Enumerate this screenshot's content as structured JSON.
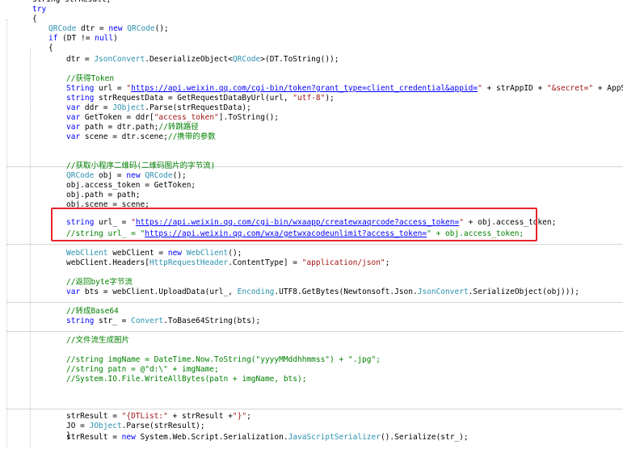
{
  "editor": {
    "lines": [
      [
        [
          "g",
          "string strResult;"
        ]
      ],
      [
        [
          "k",
          "try"
        ]
      ],
      [
        [
          "p",
          "{"
        ]
      ],
      [
        [
          "t",
          "QRCode"
        ],
        [
          "p",
          " dtr = "
        ],
        [
          "k",
          "new"
        ],
        [
          "p",
          " "
        ],
        [
          "t",
          "QRCode"
        ],
        [
          "p",
          "();"
        ]
      ],
      [
        [
          "k",
          "if"
        ],
        [
          "p",
          " (DT != "
        ],
        [
          "k",
          "null"
        ],
        [
          "p",
          ")"
        ]
      ],
      [
        [
          "p",
          "{"
        ]
      ],
      [
        [
          "p",
          "dtr = "
        ],
        [
          "t",
          "JsonConvert"
        ],
        [
          "p",
          ".DeserializeObject<"
        ],
        [
          "t",
          "QRCode"
        ],
        [
          "p",
          ">(DT.ToString());"
        ]
      ],
      [],
      [
        [
          "c",
          "//获得Token"
        ]
      ],
      [
        [
          "k",
          "String"
        ],
        [
          "p",
          " url = "
        ],
        [
          "s",
          "\""
        ],
        [
          "u",
          "https://api.weixin.qq.com/cgi-bin/token?grant_type=client_credential&appid="
        ],
        [
          "s",
          "\""
        ],
        [
          "p",
          " + strAppID + "
        ],
        [
          "s",
          "\"&secret=\""
        ],
        [
          "p",
          " + AppSecret;"
        ]
      ],
      [
        [
          "k",
          "string"
        ],
        [
          "p",
          " strRequestData = GetRequestDataByUrl(url, "
        ],
        [
          "s",
          "\"utf-8\""
        ],
        [
          "p",
          ");"
        ]
      ],
      [
        [
          "k",
          "var"
        ],
        [
          "p",
          " ddr = "
        ],
        [
          "t",
          "JObject"
        ],
        [
          "p",
          ".Parse(strRequestData);"
        ]
      ],
      [
        [
          "k",
          "var"
        ],
        [
          "p",
          " GetToken = ddr["
        ],
        [
          "s",
          "\"access_token\""
        ],
        [
          "p",
          "].ToString();"
        ]
      ],
      [
        [
          "k",
          "var"
        ],
        [
          "p",
          " path = dtr.path;"
        ],
        [
          "c",
          "//转跳路径"
        ]
      ],
      [
        [
          "k",
          "var"
        ],
        [
          "p",
          " scene = dtr.scene;"
        ],
        [
          "c",
          "//携带的参数"
        ]
      ],
      [],
      [],
      [
        [
          "c",
          "//获取小程序二维码(二维码图片的字节流)"
        ]
      ],
      [
        [
          "t",
          "QRCode"
        ],
        [
          "p",
          " obj = "
        ],
        [
          "k",
          "new"
        ],
        [
          "p",
          " "
        ],
        [
          "t",
          "QRCode"
        ],
        [
          "p",
          "();"
        ]
      ],
      [
        [
          "p",
          "obj.access_token = GetToken;"
        ]
      ],
      [
        [
          "p",
          "obj.path = path;"
        ]
      ],
      [
        [
          "p",
          "obj.scene = scene;"
        ]
      ],
      [],
      [
        [
          "k",
          "string"
        ],
        [
          "p",
          " url_ = "
        ],
        [
          "s",
          "\""
        ],
        [
          "u",
          "https://api.weixin.qq.com/cgi-bin/wxaapp/createwxaqrcode?access_token="
        ],
        [
          "s",
          "\""
        ],
        [
          "p",
          " + obj.access_token;"
        ]
      ],
      [
        [
          "c",
          "//string url_ = \""
        ],
        [
          "u",
          "https://api.weixin.qq.com/wxa/getwxacodeunlimit?access_token="
        ],
        [
          "c",
          "\" + obj.access_token;"
        ]
      ],
      [],
      [
        [
          "t",
          "WebClient"
        ],
        [
          "p",
          " webClient = "
        ],
        [
          "k",
          "new"
        ],
        [
          "p",
          " "
        ],
        [
          "t",
          "WebClient"
        ],
        [
          "p",
          "();"
        ]
      ],
      [
        [
          "p",
          "webClient.Headers["
        ],
        [
          "t",
          "HttpRequestHeader"
        ],
        [
          "p",
          ".ContentType] = "
        ],
        [
          "s",
          "\"application/json\""
        ],
        [
          "p",
          ";"
        ]
      ],
      [],
      [
        [
          "c",
          "//返回byte字节流"
        ]
      ],
      [
        [
          "k",
          "var"
        ],
        [
          "p",
          " bts = webClient.UploadData(url_, "
        ],
        [
          "t",
          "Encoding"
        ],
        [
          "p",
          ".UTF8.GetBytes(Newtonsoft.Json."
        ],
        [
          "t",
          "JsonConvert"
        ],
        [
          "p",
          ".SerializeObject(obj)));"
        ]
      ],
      [],
      [
        [
          "c",
          "//转成Base64"
        ]
      ],
      [
        [
          "k",
          "string"
        ],
        [
          "p",
          " str_ = "
        ],
        [
          "t",
          "Convert"
        ],
        [
          "p",
          ".ToBase64String(bts);"
        ]
      ],
      [],
      [
        [
          "c",
          "//文件流生成图片"
        ]
      ],
      [],
      [
        [
          "c",
          "//string imgName = DateTime.Now.ToString(\"yyyyMMddhhmmss\") + \".jpg\";"
        ]
      ],
      [
        [
          "c",
          "//string patn = @\"d:\\\" + imgName;"
        ]
      ],
      [
        [
          "c",
          "//System.IO.File.WriteAllBytes(patn + imgName, bts);"
        ]
      ],
      [],
      [],
      [],
      [],
      [],
      [
        [
          "p",
          "strResult = "
        ],
        [
          "k",
          "new"
        ],
        [
          "p",
          " System.Web.Script.Serialization."
        ],
        [
          "t",
          "JavaScriptSerializer"
        ],
        [
          "p",
          "().Serialize(str_);"
        ]
      ],
      [
        [
          "p",
          "strResult = "
        ],
        [
          "s",
          "\"{DTList:\""
        ],
        [
          "p",
          " + strResult +"
        ],
        [
          "s",
          "\"}\""
        ],
        [
          "p",
          ";"
        ]
      ],
      [
        [
          "p",
          "JO = "
        ],
        [
          "t",
          "JObject"
        ],
        [
          "p",
          ".Parse(strResult);"
        ]
      ],
      [
        [
          "p",
          "}"
        ]
      ]
    ]
  }
}
